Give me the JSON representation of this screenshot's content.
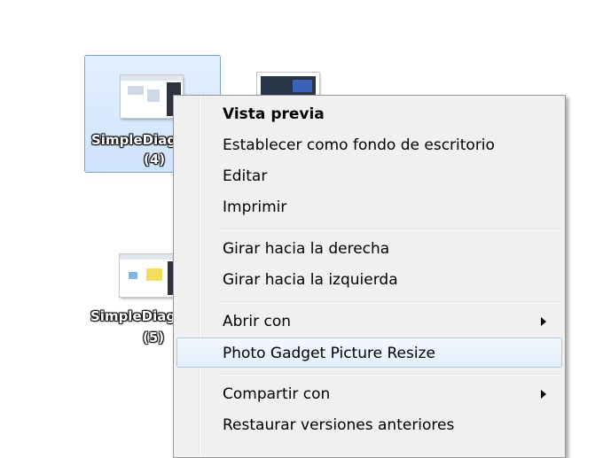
{
  "desktop": {
    "icons": [
      {
        "label": "SimpleDiag",
        "count": "(4)"
      },
      {
        "label": "SimpleDiag",
        "count": "(5)"
      }
    ]
  },
  "context_menu": {
    "items": [
      {
        "label": "Vista previa"
      },
      {
        "label": "Establecer como fondo de escritorio"
      },
      {
        "label": "Editar"
      },
      {
        "label": "Imprimir"
      },
      {
        "label": "Girar hacia la derecha"
      },
      {
        "label": "Girar hacia la izquierda"
      },
      {
        "label": "Abrir con"
      },
      {
        "label": "Photo Gadget Picture Resize"
      },
      {
        "label": "Compartir con"
      },
      {
        "label": "Restaurar versiones anteriores"
      }
    ]
  }
}
